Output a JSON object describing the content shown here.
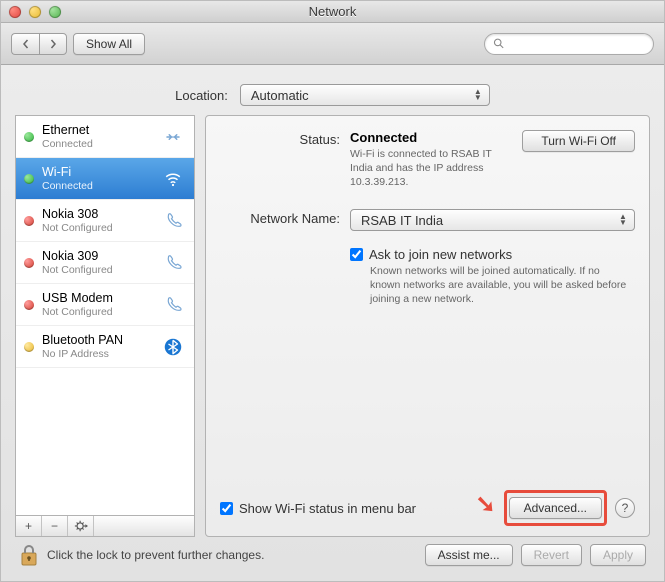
{
  "window": {
    "title": "Network"
  },
  "toolbar": {
    "show_all_label": "Show All"
  },
  "search": {
    "placeholder": ""
  },
  "location": {
    "label": "Location:",
    "value": "Automatic"
  },
  "services": [
    {
      "name": "Ethernet",
      "sub": "Connected",
      "dot": "green",
      "icon": "ethernet",
      "selected": false
    },
    {
      "name": "Wi-Fi",
      "sub": "Connected",
      "dot": "green",
      "icon": "wifi",
      "selected": true
    },
    {
      "name": "Nokia 308",
      "sub": "Not Configured",
      "dot": "red",
      "icon": "phone",
      "selected": false
    },
    {
      "name": "Nokia 309",
      "sub": "Not Configured",
      "dot": "red",
      "icon": "phone",
      "selected": false
    },
    {
      "name": "USB Modem",
      "sub": "Not Configured",
      "dot": "red",
      "icon": "phone",
      "selected": false
    },
    {
      "name": "Bluetooth PAN",
      "sub": "No IP Address",
      "dot": "yellow",
      "icon": "bluetooth",
      "selected": false
    }
  ],
  "status": {
    "label": "Status:",
    "value": "Connected",
    "turn_off_label": "Turn Wi-Fi Off",
    "desc": "Wi-Fi is connected to RSAB IT India and has the IP address 10.3.39.213."
  },
  "network_name": {
    "label": "Network Name:",
    "value": "RSAB IT India"
  },
  "ask_join": {
    "label": "Ask to join new networks",
    "desc": "Known networks will be joined automatically. If no known networks are available, you will be asked before joining a new network."
  },
  "show_in_menu": {
    "label": "Show Wi-Fi status in menu bar"
  },
  "advanced": {
    "label": "Advanced..."
  },
  "lock": {
    "text": "Click the lock to prevent further changes."
  },
  "actions": {
    "assist": "Assist me...",
    "revert": "Revert",
    "apply": "Apply"
  }
}
